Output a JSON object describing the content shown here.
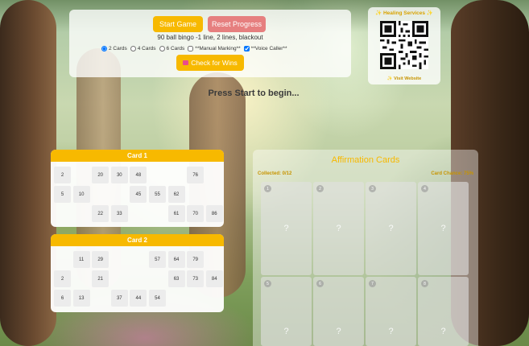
{
  "controls": {
    "start_label": "Start Game",
    "reset_label": "Reset Progress",
    "subtitle": "90 ball bingo -1 line, 2 lines, blackout",
    "options": [
      {
        "label": "2 Cards",
        "type": "radio",
        "checked": true
      },
      {
        "label": "4 Cards",
        "type": "radio",
        "checked": false
      },
      {
        "label": "6 Cards",
        "type": "radio",
        "checked": false
      },
      {
        "label": "**Manual Marking**",
        "type": "checkbox",
        "checked": false
      },
      {
        "label": "**Voice Caller**",
        "type": "checkbox",
        "checked": true
      }
    ],
    "check_label": "Check for Wins"
  },
  "qr": {
    "title": "✨ Healing Services ✨",
    "link": "✨ Visit Website"
  },
  "prompt": "Press Start to begin...",
  "cards": [
    {
      "title": "Card 1",
      "rows": [
        [
          "2",
          "",
          "20",
          "30",
          "48",
          "",
          "",
          "76",
          ""
        ],
        [
          "5",
          "10",
          "",
          "",
          "45",
          "55",
          "62",
          "",
          ""
        ],
        [
          "",
          "",
          "22",
          "33",
          "",
          "",
          "61",
          "70",
          "86"
        ]
      ]
    },
    {
      "title": "Card 2",
      "rows": [
        [
          "",
          "11",
          "29",
          "",
          "",
          "57",
          "64",
          "79",
          ""
        ],
        [
          "2",
          "",
          "21",
          "",
          "",
          "",
          "63",
          "73",
          "84"
        ],
        [
          "6",
          "13",
          "",
          "37",
          "44",
          "54",
          "",
          "",
          ""
        ]
      ]
    }
  ],
  "affirmations": {
    "title": "Affirmation Cards",
    "collected": "Collected: 0/12",
    "chance": "Card Chance: 75%",
    "cards": [
      {
        "num": "1",
        "symbol": "?"
      },
      {
        "num": "2",
        "symbol": "?"
      },
      {
        "num": "3",
        "symbol": "?"
      },
      {
        "num": "4",
        "symbol": "?"
      },
      {
        "num": "5",
        "symbol": "?"
      },
      {
        "num": "6",
        "symbol": "?"
      },
      {
        "num": "7",
        "symbol": "?"
      },
      {
        "num": "8",
        "symbol": "?"
      }
    ]
  },
  "colors": {
    "accent": "#f7b900",
    "reset": "#e67f7f",
    "check_icon": "#e94b8c"
  },
  "icons": {
    "check_button": "envelope-icon"
  }
}
